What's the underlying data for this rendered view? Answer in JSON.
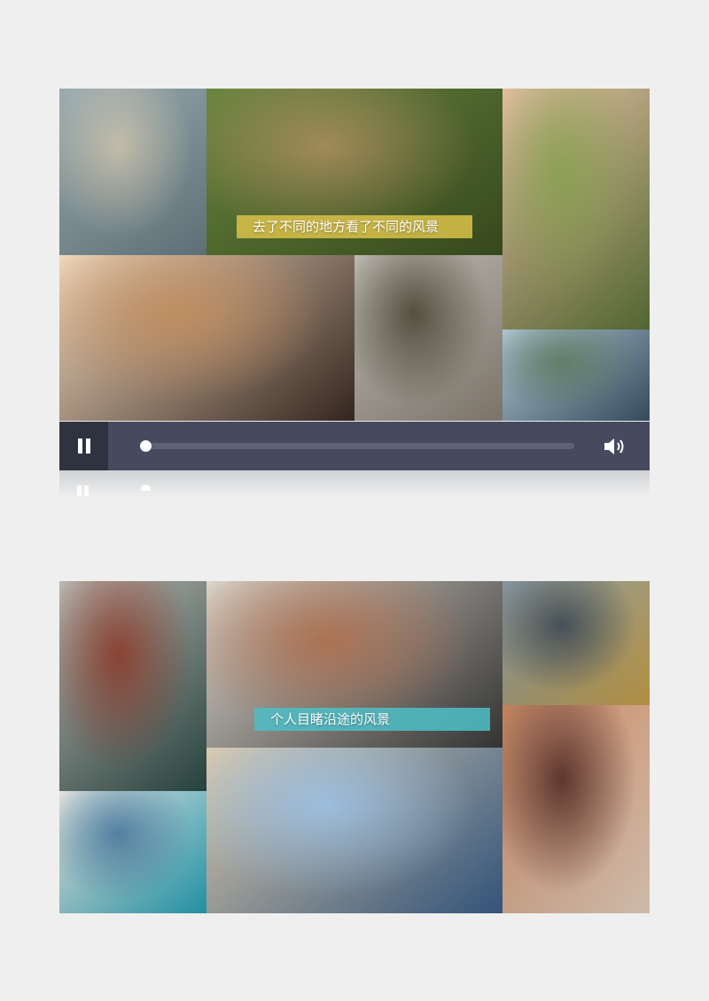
{
  "video1": {
    "caption": "去了不同的地方看了不同的风景",
    "tiles": [
      {
        "name": "map-photo",
        "colors": [
          "#8fa3a9",
          "#c7c1ac",
          "#6a7f86"
        ]
      },
      {
        "name": "photographer-hat-photo",
        "colors": [
          "#5b7a2e",
          "#a48a55",
          "#3d5220"
        ]
      },
      {
        "name": "arms-raised-field-photo",
        "colors": [
          "#e3b99d",
          "#8ca24e",
          "#5d7438"
        ]
      },
      {
        "name": "camera-lens-closeup-photo",
        "colors": [
          "#f1d6b8",
          "#c58f5e",
          "#3b2c24"
        ]
      },
      {
        "name": "couple-laughing-photo",
        "colors": [
          "#bbb6ad",
          "#4e4b3a",
          "#8c8377"
        ]
      },
      {
        "name": "mountain-lake-photo",
        "colors": [
          "#a9c3d2",
          "#5f7c64",
          "#3d5467"
        ]
      }
    ]
  },
  "player": {
    "progress": 0.0,
    "pause_icon": "pause-icon",
    "volume_icon": "volume-icon"
  },
  "video2": {
    "caption": "个人目睹沿途的风景",
    "tiles": [
      {
        "name": "gabled-building-photo",
        "colors": [
          "#b7b4ae",
          "#8a3b2a",
          "#2c4a45"
        ]
      },
      {
        "name": "photographer-rooftops-photo",
        "colors": [
          "#d9d3c8",
          "#b0704e",
          "#3a3a3a"
        ]
      },
      {
        "name": "city-skyscraper-photo",
        "colors": [
          "#7c8f9a",
          "#3f4b52",
          "#c9a24a"
        ]
      },
      {
        "name": "polaroid-photo",
        "colors": [
          "#e6e2dc",
          "#4f7fa3",
          "#27a3b8"
        ]
      },
      {
        "name": "stone-arches-photo",
        "colors": [
          "#d8c7a8",
          "#9ec3e6",
          "#3a5f8a"
        ]
      },
      {
        "name": "tripod-photographer-photo",
        "colors": [
          "#c07a52",
          "#5a2e25",
          "#e9d4c1"
        ]
      }
    ]
  }
}
